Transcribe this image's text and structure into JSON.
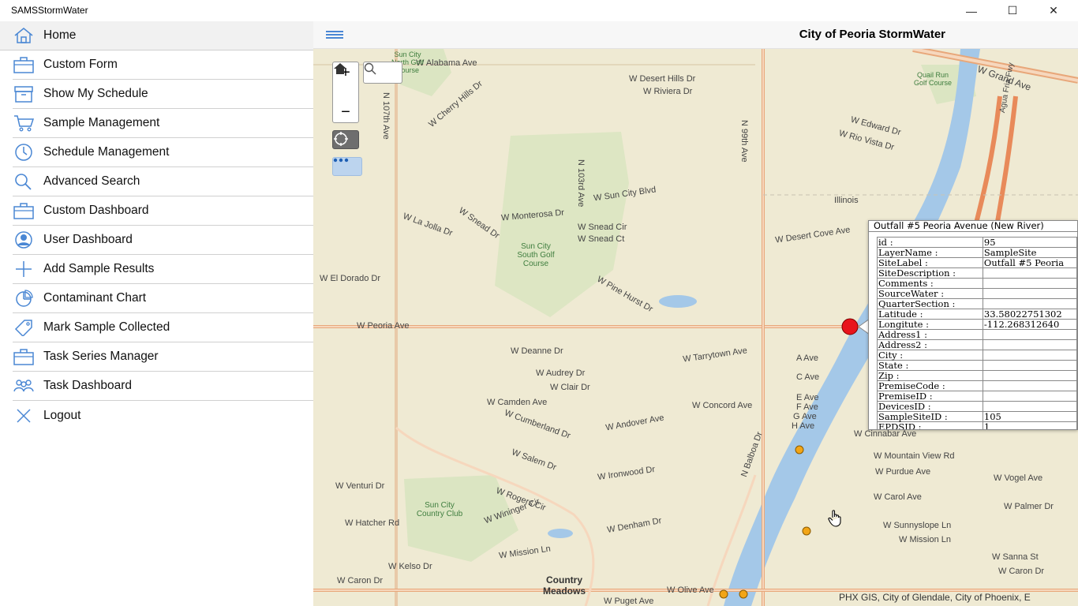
{
  "app": {
    "title": "SAMSStormWater"
  },
  "window": {
    "minimize": "—",
    "maximize": "☐",
    "close": "✕"
  },
  "header": {
    "title": "City of Peoria StormWater"
  },
  "nav": [
    {
      "label": "Home",
      "icon": "home-icon"
    },
    {
      "label": "Custom Form",
      "icon": "briefcase-icon"
    },
    {
      "label": "Show My Schedule",
      "icon": "archive-icon"
    },
    {
      "label": "Sample Management",
      "icon": "cart-icon"
    },
    {
      "label": "Schedule Management",
      "icon": "clock-icon"
    },
    {
      "label": "Advanced Search",
      "icon": "search-icon"
    },
    {
      "label": "Custom Dashboard",
      "icon": "briefcase-icon"
    },
    {
      "label": "User Dashboard",
      "icon": "user-icon"
    },
    {
      "label": "Add Sample Results",
      "icon": "plus-icon"
    },
    {
      "label": "Contaminant Chart",
      "icon": "pie-chart-icon"
    },
    {
      "label": "Mark Sample Collected",
      "icon": "tag-icon"
    },
    {
      "label": "Task Series Manager",
      "icon": "briefcase-icon"
    },
    {
      "label": "Task Dashboard",
      "icon": "people-icon"
    },
    {
      "label": "Logout",
      "icon": "close-icon"
    }
  ],
  "map": {
    "labels": [
      "W Alabama Ave",
      "W Desert Hills Dr",
      "W Riviera Dr",
      "W Cherry Hills Dr",
      "W Sun City Blvd",
      "W Monterosa Dr",
      "W La Jolla Dr",
      "W Snead Dr",
      "W Snead Cir",
      "W Snead Ct",
      "Sun City South Golf Course",
      "W El Dorado Dr",
      "W Pine Hurst Dr",
      "W Peoria Ave",
      "W Deanne Dr",
      "W Audrey Dr",
      "W Clair Dr",
      "W Camden Ave",
      "W Cumberland Dr",
      "W Andover Ave",
      "W Concord Ave",
      "W Cinnabar Ave",
      "W Salem Dr",
      "W Ironwood Dr",
      "W Venturi Dr",
      "W Rogers Cir",
      "W Wininger Cir",
      "W Hatcher Rd",
      "W Denham Dr",
      "W Mission Ln",
      "W Kelso Dr",
      "W Caron Dr",
      "W Olive Ave",
      "W Puget Ave",
      "Sun City Country Club",
      "Country Meadows",
      "W Desert Cove Ave",
      "Illinois",
      "W Grand Ave",
      "Quail Run Golf Course",
      "W Edward Dr",
      "W Rio Vista Dr",
      "W Mountain View Rd",
      "W Purdue Ave",
      "W Vogel Ave",
      "W Carol Ave",
      "W Palmer Dr",
      "W Sunnyslope Ln",
      "W Mission Ln",
      "W Sanna St",
      "W Caron Dr",
      "N 99th Ave",
      "N 103rd Ave",
      "N 107th Ave",
      "N Balboa Dr",
      "Sun City North Golf Course",
      "W Tarrytown Ave",
      "A Ave",
      "C Ave",
      "E Ave",
      "F Ave",
      "G Ave",
      "H Ave",
      "Agua Fria Fwy"
    ],
    "attribution": "PHX GIS, City of Glendale, City of Phoenix, E"
  },
  "popup": {
    "title": "Outfall #5 Peoria Avenue (New River)",
    "rows": [
      {
        "key": "id :",
        "value": "95"
      },
      {
        "key": "LayerName :",
        "value": "SampleSite"
      },
      {
        "key": "SiteLabel :",
        "value": "Outfall #5 Peoria"
      },
      {
        "key": "SiteDescription :",
        "value": ""
      },
      {
        "key": "Comments :",
        "value": ""
      },
      {
        "key": "SourceWater :",
        "value": ""
      },
      {
        "key": "QuarterSection :",
        "value": ""
      },
      {
        "key": "Latitude :",
        "value": "33.58022751302"
      },
      {
        "key": "Longitute :",
        "value": "-112.268312640"
      },
      {
        "key": "Address1 :",
        "value": ""
      },
      {
        "key": "Address2 :",
        "value": ""
      },
      {
        "key": "City :",
        "value": ""
      },
      {
        "key": "State :",
        "value": ""
      },
      {
        "key": "Zip :",
        "value": ""
      },
      {
        "key": "PremiseCode :",
        "value": ""
      },
      {
        "key": "PremiseID :",
        "value": ""
      },
      {
        "key": "DevicesID :",
        "value": ""
      },
      {
        "key": "SampleSiteID :",
        "value": "105"
      },
      {
        "key": "EPDSID :",
        "value": "1"
      }
    ]
  },
  "colors": {
    "accent": "#4a87d4",
    "selected_point": "#e8141c",
    "site_point": "#f2a516",
    "river": "#a4c8e8"
  }
}
